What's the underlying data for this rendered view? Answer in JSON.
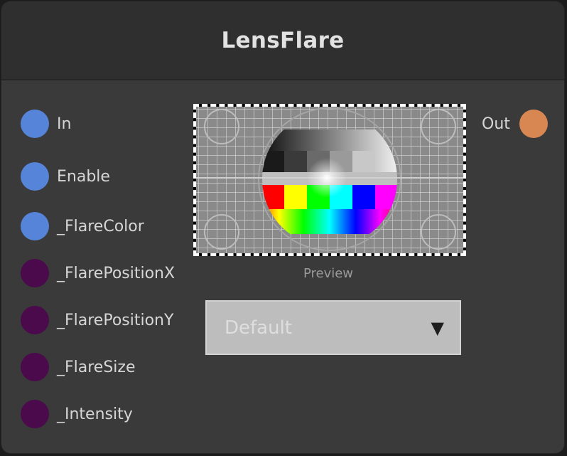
{
  "node": {
    "title": "LensFlare"
  },
  "inputs": [
    {
      "label": "In",
      "color": "#5584d8"
    },
    {
      "label": "Enable",
      "color": "#5584d8"
    },
    {
      "label": "_FlareColor",
      "color": "#5584d8"
    },
    {
      "label": "_FlarePositionX",
      "color": "#4a0a4c"
    },
    {
      "label": "_FlarePositionY",
      "color": "#4a0a4c"
    },
    {
      "label": "_FlareSize",
      "color": "#4a0a4c"
    },
    {
      "label": "_Intensity",
      "color": "#4a0a4c"
    }
  ],
  "outputs": [
    {
      "label": "Out",
      "color": "#d98752"
    }
  ],
  "preview": {
    "label": "Preview",
    "image": "test-pattern"
  },
  "dropdown": {
    "value": "Default",
    "icon": "triangle-down-icon"
  }
}
